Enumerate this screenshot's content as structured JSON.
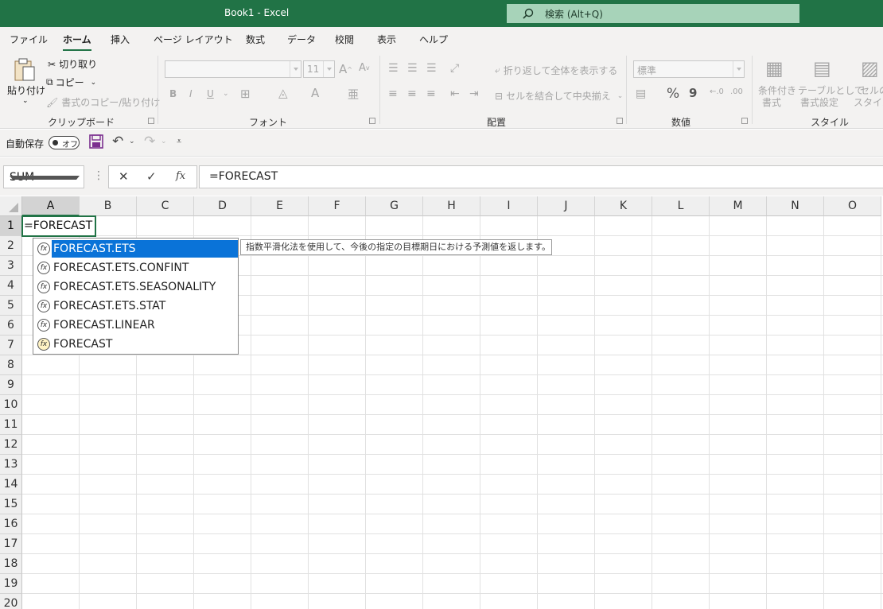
{
  "titlebar": {
    "title": "Book1  -  Excel",
    "search_placeholder": "検索 (Alt+Q)"
  },
  "tabs": [
    {
      "label": "ファイル",
      "active": false
    },
    {
      "label": "ホーム",
      "active": true
    },
    {
      "label": "挿入",
      "active": false
    },
    {
      "label": "ページ レイアウト",
      "active": false
    },
    {
      "label": "数式",
      "active": false
    },
    {
      "label": "データ",
      "active": false
    },
    {
      "label": "校閲",
      "active": false
    },
    {
      "label": "表示",
      "active": false
    },
    {
      "label": "ヘルプ",
      "active": false
    }
  ],
  "ribbon": {
    "clipboard": {
      "group": "クリップボード",
      "paste": "貼り付け",
      "cut": "切り取り",
      "copy": "コピー",
      "format_painter": "書式のコピー/貼り付け"
    },
    "font": {
      "group": "フォント",
      "size": "11",
      "bold": "B",
      "italic": "I",
      "underline": "U"
    },
    "alignment": {
      "group": "配置",
      "wrap_text": "折り返して全体を表示する",
      "merge_center": "セルを結合して中央揃え"
    },
    "number": {
      "group": "数値",
      "format": "標準",
      "percent": "%",
      "comma": "9"
    },
    "styles": {
      "group": "スタイル",
      "conditional_1": "条件付き",
      "conditional_2": "書式",
      "table_1": "テーブルとして",
      "table_2": "書式設定",
      "cell_1": "セルの",
      "cell_2": "スタイル"
    }
  },
  "qat": {
    "autosave": "自動保存",
    "toggle": "オフ"
  },
  "formula_bar": {
    "namebox": "SUM",
    "fx": "fx",
    "content": "=FORECAST"
  },
  "grid": {
    "columns": [
      "A",
      "B",
      "C",
      "D",
      "E",
      "F",
      "G",
      "H",
      "I",
      "J",
      "K",
      "L",
      "M",
      "N",
      "O"
    ],
    "rows": [
      "1",
      "2",
      "3",
      "4",
      "5",
      "6",
      "7",
      "8",
      "9",
      "10",
      "11",
      "12",
      "13",
      "14",
      "15",
      "16",
      "17",
      "18",
      "19",
      "20"
    ],
    "active_cell_text": "=FORECAST"
  },
  "autocomplete": {
    "items": [
      {
        "label": "FORECAST.ETS",
        "selected": true
      },
      {
        "label": "FORECAST.ETS.CONFINT",
        "selected": false
      },
      {
        "label": "FORECAST.ETS.SEASONALITY",
        "selected": false
      },
      {
        "label": "FORECAST.ETS.STAT",
        "selected": false
      },
      {
        "label": "FORECAST.LINEAR",
        "selected": false
      },
      {
        "label": "FORECAST",
        "selected": false
      }
    ],
    "tooltip": "指数平滑化法を使用して、今後の指定の目標期日における予測値を返します。"
  },
  "colors": {
    "accent": "#217346",
    "selection": "#0a73d8"
  }
}
